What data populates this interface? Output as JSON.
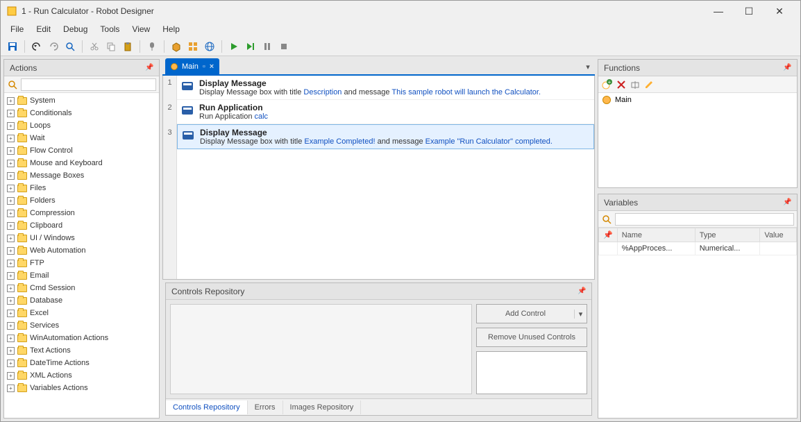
{
  "window": {
    "title": "1 - Run Calculator - Robot Designer",
    "menus": [
      "File",
      "Edit",
      "Debug",
      "Tools",
      "View",
      "Help"
    ]
  },
  "panels": {
    "actions": {
      "title": "Actions"
    },
    "functions": {
      "title": "Functions"
    },
    "variables": {
      "title": "Variables"
    },
    "controls": {
      "title": "Controls Repository"
    }
  },
  "action_tree": [
    "System",
    "Conditionals",
    "Loops",
    "Wait",
    "Flow Control",
    "Mouse and Keyboard",
    "Message Boxes",
    "Files",
    "Folders",
    "Compression",
    "Clipboard",
    "UI / Windows",
    "Web Automation",
    "FTP",
    "Email",
    "Cmd Session",
    "Database",
    "Excel",
    "Services",
    "WinAutomation Actions",
    "Text Actions",
    "DateTime Actions",
    "XML Actions",
    "Variables Actions"
  ],
  "tab": {
    "label": "Main"
  },
  "steps": [
    {
      "num": "1",
      "title": "Display Message",
      "parts": [
        "Display Message box with title ",
        {
          "kw": "Description"
        },
        " and message ",
        {
          "kw": "This sample robot will launch the Calculator."
        }
      ]
    },
    {
      "num": "2",
      "title": "Run Application",
      "parts": [
        "Run Application ",
        {
          "kw": "calc"
        }
      ]
    },
    {
      "num": "3",
      "title": "Display Message",
      "selected": true,
      "parts": [
        "Display Message box with title ",
        {
          "kw": "Example Completed!"
        },
        " and message ",
        {
          "kw": "Example \"Run Calculator\" completed."
        }
      ]
    }
  ],
  "controls_buttons": {
    "add": "Add Control",
    "remove": "Remove Unused Controls"
  },
  "bottom_tabs": [
    "Controls Repository",
    "Errors",
    "Images Repository"
  ],
  "functions_list": [
    {
      "name": "Main"
    }
  ],
  "variables_table": {
    "headers": [
      "Name",
      "Type",
      "Value"
    ],
    "rows": [
      {
        "name": "%AppProces...",
        "type": "Numerical...",
        "value": ""
      }
    ]
  }
}
